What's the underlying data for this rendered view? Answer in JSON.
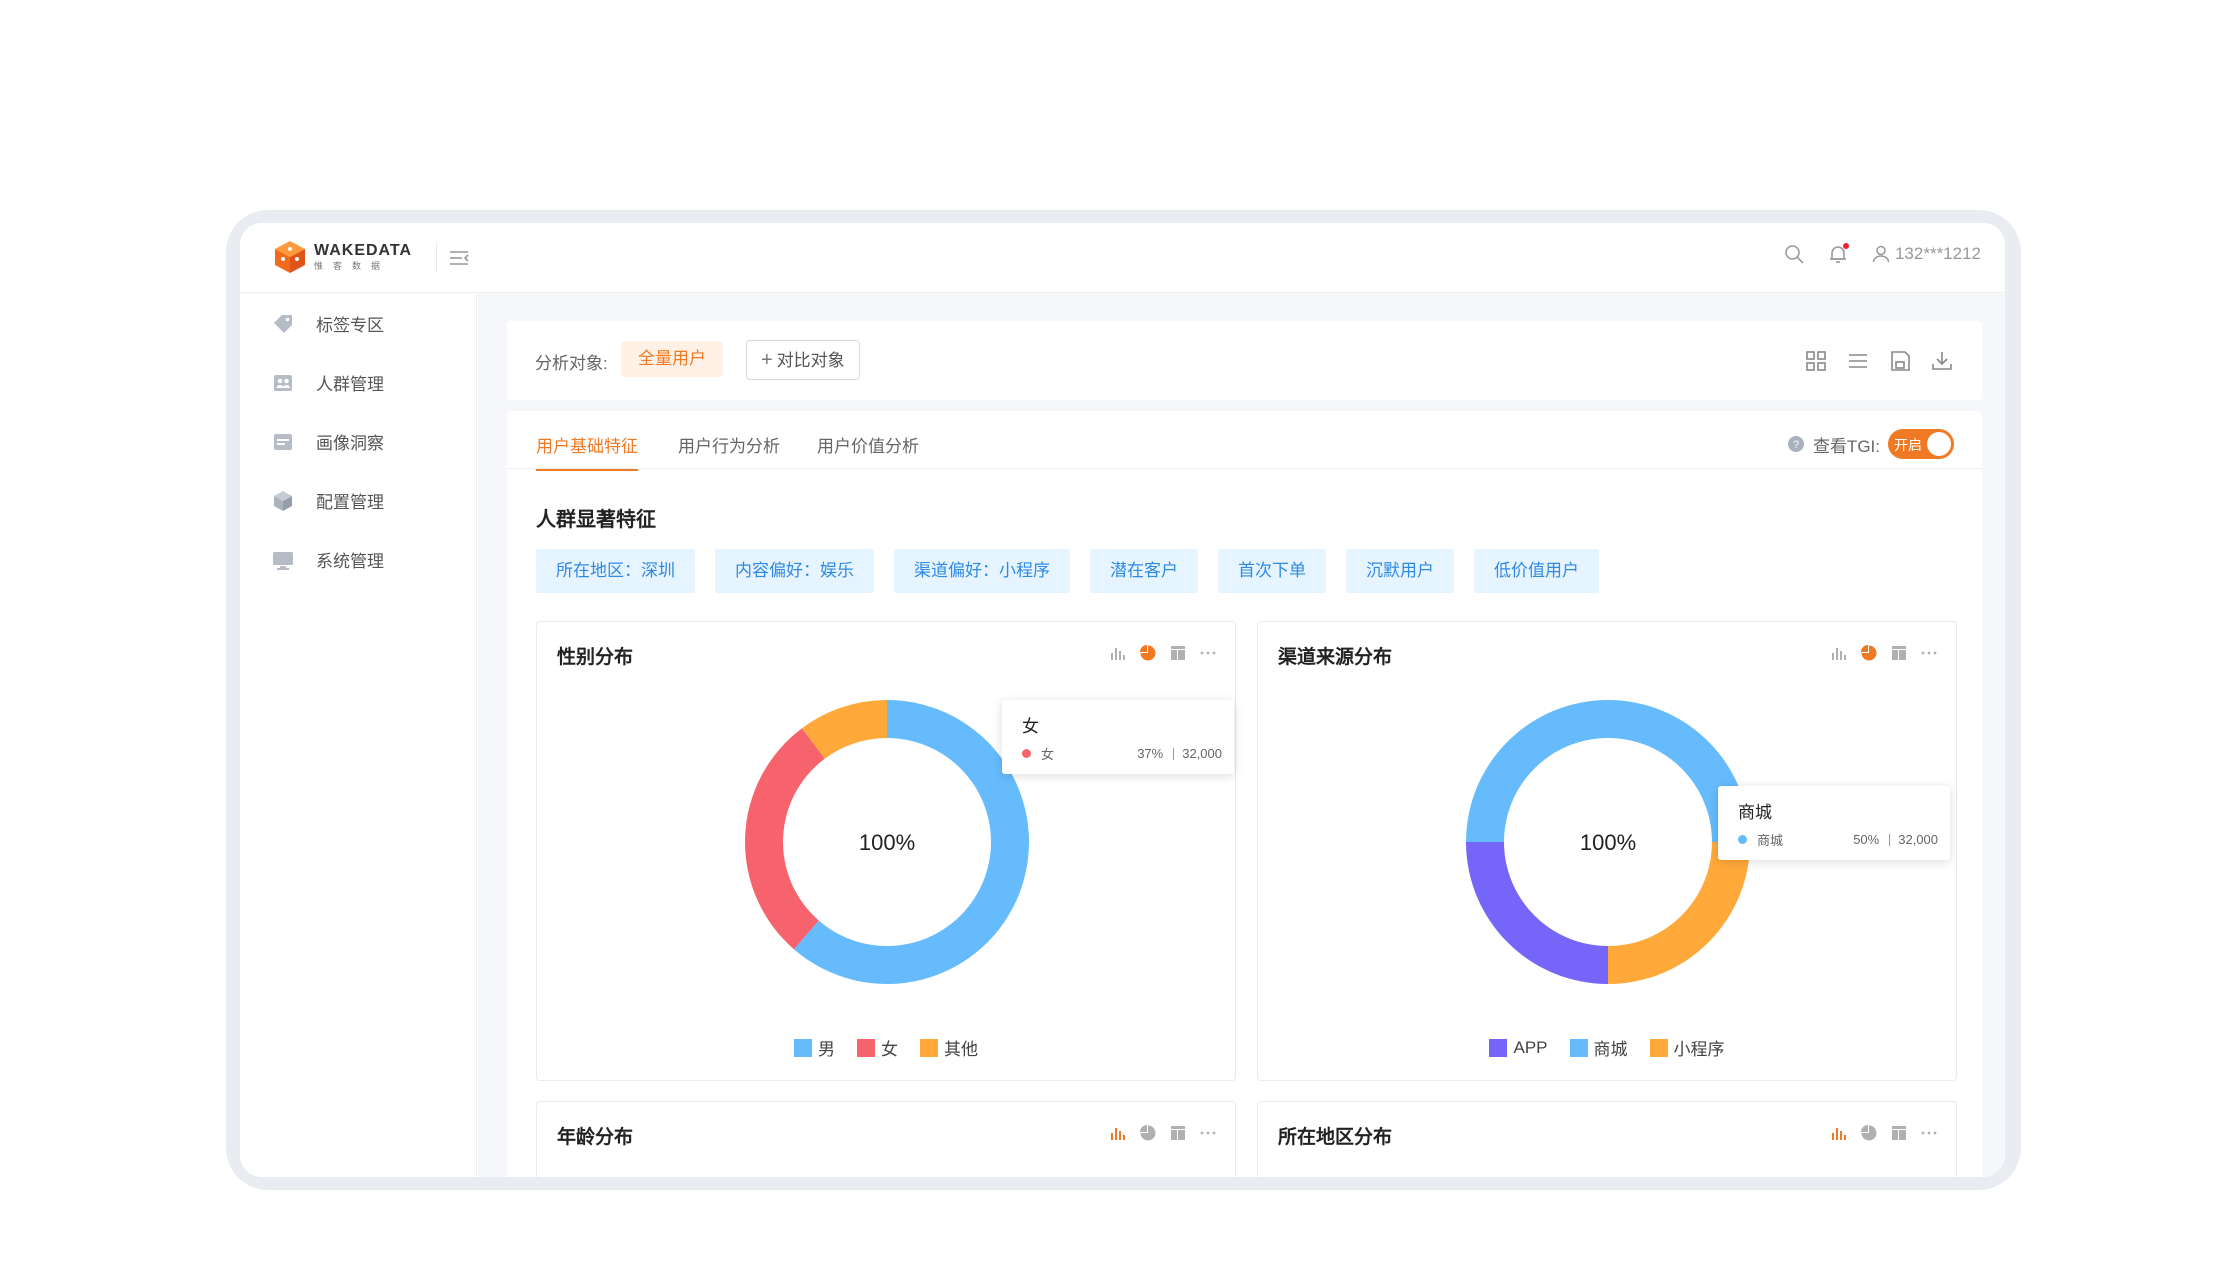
{
  "brand": {
    "name": "WAKEDATA",
    "sub": "惟客数据"
  },
  "user": {
    "account": "132***1212"
  },
  "sidebar": {
    "items": [
      {
        "label": "标签专区",
        "icon": "tag-icon"
      },
      {
        "label": "人群管理",
        "icon": "people-icon"
      },
      {
        "label": "画像洞察",
        "icon": "portrait-icon"
      },
      {
        "label": "配置管理",
        "icon": "cube-icon"
      },
      {
        "label": "系统管理",
        "icon": "monitor-icon"
      }
    ]
  },
  "filter": {
    "label": "分析对象:",
    "selected": "全量用户",
    "compare": "对比对象"
  },
  "tabs": [
    {
      "label": "用户基础特征",
      "active": true
    },
    {
      "label": "用户行为分析",
      "active": false
    },
    {
      "label": "用户价值分析",
      "active": false
    }
  ],
  "tgi": {
    "label": "查看TGI:",
    "toggle": "开启"
  },
  "features": {
    "title": "人群显著特征",
    "tags": [
      "所在地区：深圳",
      "内容偏好：娱乐",
      "渠道偏好：小程序",
      "潜在客户",
      "首次下单",
      "沉默用户",
      "低价值用户"
    ]
  },
  "colors": {
    "accent": "#f07a23",
    "blue": "#65bbfc",
    "red": "#f7636c",
    "orange": "#ffa93a",
    "purple": "#7566f9"
  },
  "cards": {
    "gender": {
      "title": "性别分布"
    },
    "channel": {
      "title": "渠道来源分布"
    },
    "age": {
      "title": "年龄分布"
    },
    "region": {
      "title": "所在地区分布"
    }
  },
  "chart_data": [
    {
      "type": "pie",
      "title": "性别分布",
      "center_label": "100%",
      "categories": [
        "男",
        "女",
        "其他"
      ],
      "values": [
        54,
        25,
        9
      ],
      "colors": [
        "#65bbfc",
        "#f7636c",
        "#ffa93a"
      ],
      "start_angle_deg": 0,
      "tooltip": {
        "title": "女",
        "name": "女",
        "percent": "37%",
        "value": "32,000"
      }
    },
    {
      "type": "pie",
      "title": "渠道来源分布",
      "center_label": "100%",
      "categories": [
        "APP",
        "商城",
        "小程序"
      ],
      "values": [
        25,
        50,
        25
      ],
      "colors": [
        "#7566f9",
        "#65bbfc",
        "#ffa93a"
      ],
      "start_angle_deg": 180,
      "tooltip": {
        "title": "商城",
        "name": "商城",
        "percent": "50%",
        "value": "32,000"
      }
    }
  ]
}
